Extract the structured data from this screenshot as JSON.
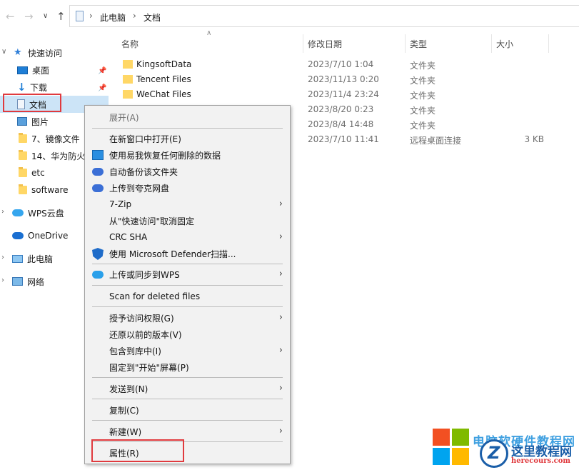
{
  "address_bar": {
    "crumbs": [
      "此电脑",
      "文档"
    ]
  },
  "nav_pane": {
    "items": [
      {
        "label": "快速访问"
      },
      {
        "label": "桌面"
      },
      {
        "label": "下载"
      },
      {
        "label": "文档"
      },
      {
        "label": "图片"
      },
      {
        "label": "7、镜像文件"
      },
      {
        "label": "14、华为防火"
      },
      {
        "label": "etc"
      },
      {
        "label": "software"
      },
      {
        "label": "WPS云盘"
      },
      {
        "label": "OneDrive"
      },
      {
        "label": "此电脑"
      },
      {
        "label": "网络"
      }
    ]
  },
  "columns": {
    "name": "名称",
    "date": "修改日期",
    "type": "类型",
    "size": "大小"
  },
  "files": [
    {
      "name": "KingsoftData",
      "date": "2023/7/10 1:04",
      "type": "文件夹",
      "size": ""
    },
    {
      "name": "Tencent Files",
      "date": "2023/11/13 0:20",
      "type": "文件夹",
      "size": ""
    },
    {
      "name": "WeChat Files",
      "date": "2023/11/4 23:24",
      "type": "文件夹",
      "size": ""
    },
    {
      "name": "",
      "date": "2023/8/20 0:23",
      "type": "文件夹",
      "size": ""
    },
    {
      "name": "",
      "date": "2023/8/4 14:48",
      "type": "文件夹",
      "size": ""
    },
    {
      "name": "",
      "date": "2023/7/10 11:41",
      "type": "远程桌面连接",
      "size": "3 KB"
    }
  ],
  "context_menu": {
    "items": [
      {
        "label": "展开(A)"
      },
      {
        "label": "在新窗口中打开(E)"
      },
      {
        "label": "使用易我恢复任何删除的数据"
      },
      {
        "label": "自动备份该文件夹"
      },
      {
        "label": "上传到夸克网盘"
      },
      {
        "label": "7-Zip"
      },
      {
        "label": "从\"快速访问\"取消固定"
      },
      {
        "label": "CRC SHA"
      },
      {
        "label": "使用 Microsoft Defender扫描..."
      },
      {
        "label": "上传或同步到WPS"
      },
      {
        "label": "Scan for deleted files"
      },
      {
        "label": "授予访问权限(G)"
      },
      {
        "label": "还原以前的版本(V)"
      },
      {
        "label": "包含到库中(I)"
      },
      {
        "label": "固定到\"开始\"屏幕(P)"
      },
      {
        "label": "发送到(N)"
      },
      {
        "label": "复制(C)"
      },
      {
        "label": "新建(W)"
      },
      {
        "label": "属性(R)"
      }
    ]
  },
  "watermark": {
    "line1": "电脑软硬件教程网",
    "line2": "这里教程网",
    "line3": "herecours.com"
  },
  "colors": {
    "selection": "#cce4f7",
    "highlight_box": "#e03a3e",
    "menu_bg": "#f2f2f2"
  }
}
